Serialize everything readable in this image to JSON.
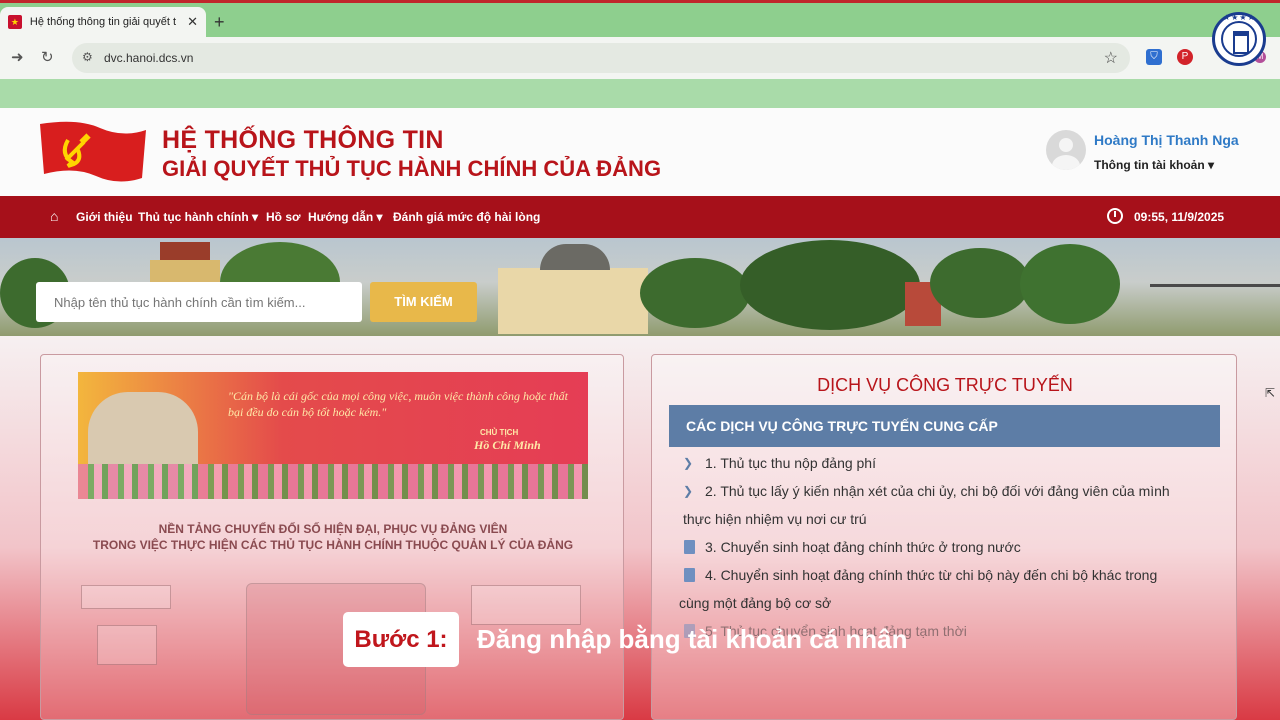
{
  "browser": {
    "tab_title": "Hệ thống thông tin giải quyết t",
    "tab_close": "✕",
    "new_tab": "+",
    "url": "dvc.hanoi.dcs.vn"
  },
  "site": {
    "title_line1": "HỆ THỐNG THÔNG TIN",
    "title_line2": "GIẢI QUYẾT THỦ TỤC HÀNH CHÍNH CỦA ĐẢNG",
    "user_name": "Hoàng Thị Thanh Nga",
    "account_label": "Thông tin tài khoản ▾"
  },
  "nav": {
    "items": [
      "Giới thiệu",
      "Thủ tục hành chính ▾",
      "Hồ sơ",
      "Hướng dẫn ▾",
      "Đánh giá mức độ hài lòng"
    ],
    "datetime": "09:55, 11/9/2025"
  },
  "search": {
    "placeholder": "Nhập tên thủ tục hành chính cần tìm kiếm...",
    "button": "TÌM KIẾM"
  },
  "left_panel": {
    "quote": "\"Cán bộ là cái gốc của mọi công việc, muôn việc thành công hoặc thất bại đều do cán bộ tốt hoặc kém.\"",
    "author_title": "CHỦ TỊCH",
    "author": "Hồ Chí Minh",
    "platform_line1": "NỀN TẢNG CHUYỂN ĐỔI SỐ HIỆN ĐẠI, PHỤC VỤ ĐẢNG VIÊN",
    "platform_line2": "TRONG VIỆC THỰC HIỆN CÁC THỦ TỤC HÀNH CHÍNH THUỘC QUẢN LÝ CỦA ĐẢNG"
  },
  "right_panel": {
    "title": "DỊCH VỤ CÔNG TRỰC TUYẾN",
    "header": "CÁC DỊCH VỤ CÔNG TRỰC TUYẾN CUNG CẤP",
    "items": [
      "1. Thủ tục thu nộp đảng phí",
      "2. Thủ tục lấy ý kiến nhận xét của chi ủy, chi bộ đối với đảng viên của mình",
      "thực hiện nhiệm vụ nơi cư trú",
      "3. Chuyển sinh hoạt đảng chính thức ở trong nước",
      "4. Chuyển sinh hoạt đảng chính thức từ chi bộ này đến chi bộ khác trong",
      "cùng một đảng bộ cơ sở",
      "5. Thủ tục chuyển sinh hoạt đảng tạm thời"
    ]
  },
  "overlay": {
    "step": "Bước 1:",
    "text": "Đăng nhập bằng tài khoản cá nhân"
  },
  "colors": {
    "party_red": "#a6101a",
    "title_red": "#b8141a",
    "browser_green": "#8ecf8e",
    "search_gold": "#e8b84a",
    "service_header": "#5d7da6"
  }
}
